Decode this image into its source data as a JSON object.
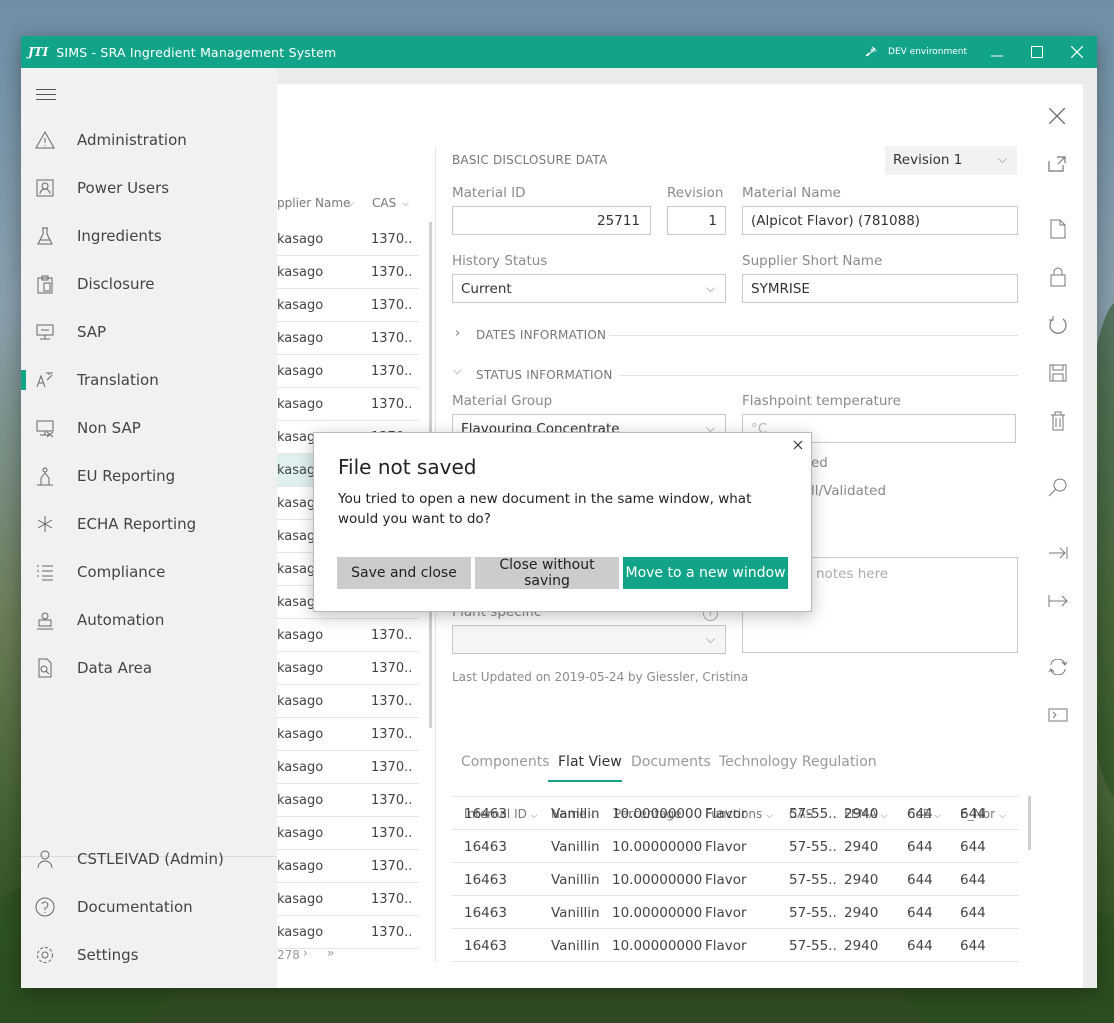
{
  "window": {
    "logo": "JTI",
    "title": "SIMS - SRA Ingredient Management System",
    "environment": "DEV environment"
  },
  "sidebar": {
    "items": [
      {
        "label": "Administration",
        "icon": "warning-icon"
      },
      {
        "label": "Power Users",
        "icon": "user-badge-icon"
      },
      {
        "label": "Ingredients",
        "icon": "flask-icon"
      },
      {
        "label": "Disclosure",
        "icon": "clipboard-icon"
      },
      {
        "label": "SAP",
        "icon": "monitor-icon"
      },
      {
        "label": "Translation",
        "icon": "translate-icon"
      },
      {
        "label": "Non SAP",
        "icon": "monitor-off-icon"
      },
      {
        "label": "EU Reporting",
        "icon": "person-stand-icon"
      },
      {
        "label": "ECHA Reporting",
        "icon": "asterisk-icon"
      },
      {
        "label": "Compliance",
        "icon": "checklist-icon"
      },
      {
        "label": "Automation",
        "icon": "robot-icon"
      },
      {
        "label": "Data Area",
        "icon": "document-search-icon"
      }
    ],
    "bottom": [
      {
        "label": "CSTLEIVAD (Admin)",
        "icon": "person-icon"
      },
      {
        "label": "Documentation",
        "icon": "help-icon"
      },
      {
        "label": "Settings",
        "icon": "gear-icon"
      }
    ]
  },
  "list": {
    "headers": [
      "pplier Name",
      "CAS"
    ],
    "row_name": "kasago",
    "row_cas": "1370..",
    "partial_row_cas": "1370",
    "pager_text": "278"
  },
  "form": {
    "section_title": "BASIC DISCLOSURE DATA",
    "revision_select": "Revision 1",
    "material_id_label": "Material ID",
    "material_id": "25711",
    "revision_label": "Revision",
    "revision": "1",
    "material_name_label": "Material Name",
    "material_name": "(Alpicot Flavor) (781088)",
    "history_status_label": "History Status",
    "history_status": "Current",
    "supplier_short_label": "Supplier Short Name",
    "supplier_short": "SYMRISE",
    "dates_section": "DATES INFORMATION",
    "status_section": "STATUS INFORMATION",
    "material_group_label": "Material Group",
    "material_group": "Flavouring Concentrate",
    "flashpoint_label": "Flashpoint temperature",
    "flashpoint_placeholder": "°C",
    "partial_ed": "ed",
    "partial_validated": "ll/Validated",
    "notes_placeholder": "notes here",
    "plant_specific_label": "Plant specific",
    "last_updated": "Last Updated on 2019-05-24 by Giessler, Cristina"
  },
  "tabs": [
    "Components",
    "Flat View",
    "Documents",
    "Technology Regulation"
  ],
  "grid": {
    "headers": [
      "Internal ID",
      "Name",
      "Percentage",
      "Functions",
      "CAS",
      "FEMA",
      "CoE",
      "E_Nbr"
    ],
    "rows": [
      [
        "16463",
        "Vanillin",
        "10.00000000",
        "Flavor",
        "57-55..",
        "2940",
        "644",
        "644"
      ],
      [
        "16463",
        "Vanillin",
        "10.00000000",
        "Flavor",
        "57-55..",
        "2940",
        "644",
        "644"
      ],
      [
        "16463",
        "Vanillin",
        "10.00000000",
        "Flavor",
        "57-55..",
        "2940",
        "644",
        "644"
      ],
      [
        "16463",
        "Vanillin",
        "10.00000000",
        "Flavor",
        "57-55..",
        "2940",
        "644",
        "644"
      ],
      [
        "16463",
        "Vanillin",
        "10.00000000",
        "Flavor",
        "57-55..",
        "2940",
        "644",
        "644"
      ]
    ]
  },
  "dialog": {
    "title": "File not saved",
    "message": "You tried to open a new document in the same window, what would you want to do?",
    "save_close": "Save and close",
    "close_without": "Close without saving",
    "move_new": "Move to a new window"
  },
  "colors": {
    "accent": "#12a489"
  }
}
